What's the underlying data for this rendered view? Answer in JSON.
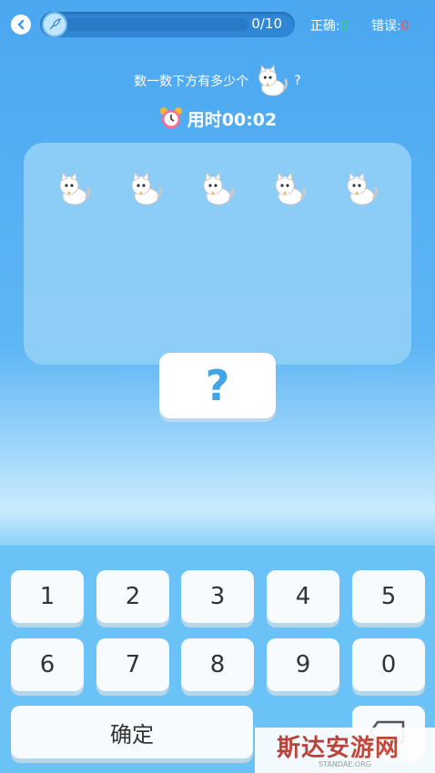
{
  "topbar": {
    "back_icon": "chevron-left-icon",
    "progress_text": "0/10",
    "progress_fraction": 0,
    "correct_label": "正确:",
    "correct_count": "0",
    "wrong_label": "错误:",
    "wrong_count": "0"
  },
  "question": {
    "text_before": "数一数下方有多少个",
    "text_after": "?",
    "icon": "cat-icon"
  },
  "timer": {
    "icon": "alarm-clock-icon",
    "label": "用时00:02"
  },
  "cats": [
    "cat-icon",
    "cat-icon",
    "cat-icon",
    "cat-icon",
    "cat-icon"
  ],
  "answer": "?",
  "keypad": {
    "row1": [
      "1",
      "2",
      "3",
      "4",
      "5"
    ],
    "row2": [
      "6",
      "7",
      "8",
      "9",
      "0"
    ],
    "confirm_label": "确定",
    "delete_icon": "backspace-icon"
  },
  "watermark": {
    "title": "斯达安游网",
    "subtitle": "STANDAE.ORG"
  },
  "colors": {
    "accent": "#41a6e8",
    "correct": "#3cd36a",
    "wrong": "#ff4a4a"
  }
}
